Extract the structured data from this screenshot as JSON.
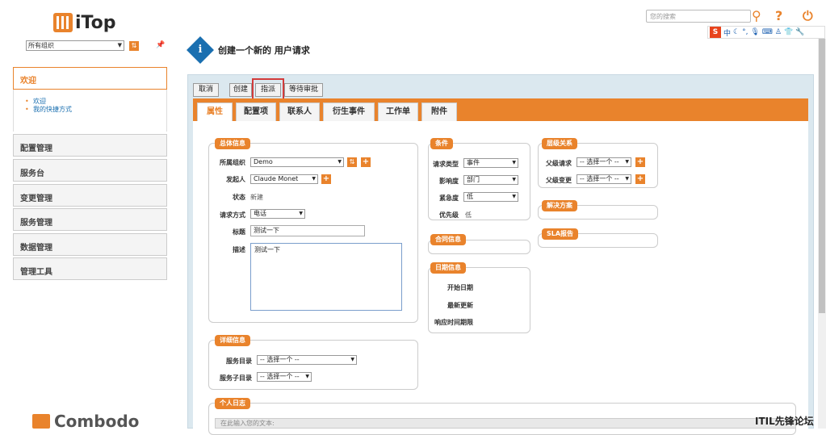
{
  "app": {
    "logo_text": "iTop",
    "footer_logo": "Combodo",
    "watermark": "ITIL先锋论坛"
  },
  "sidebar": {
    "org_select": "所有组织",
    "welcome": "欢迎",
    "sub": [
      "欢迎",
      "我的快捷方式"
    ],
    "items": [
      "配置管理",
      "服务台",
      "变更管理",
      "服务管理",
      "数据管理",
      "管理工具"
    ]
  },
  "topbar": {
    "search_placeholder": "您的搜索",
    "ime_mode": "中"
  },
  "page": {
    "title": "创建一个新的 用户请求",
    "actions": [
      "取消",
      "创建",
      "指派",
      "等待审批"
    ],
    "tabs": [
      "属性",
      "配置项",
      "联系人",
      "衍生事件",
      "工作单",
      "附件"
    ]
  },
  "general": {
    "legend": "总体信息",
    "org_label": "所属组织",
    "org_value": "Demo",
    "caller_label": "发起人",
    "caller_value": "Claude Monet",
    "status_label": "状态",
    "status_value": "新建",
    "origin_label": "请求方式",
    "origin_value": "电话",
    "title_label": "标题",
    "title_value": "测试一下",
    "desc_label": "描述",
    "desc_value": "测试一下"
  },
  "conditions": {
    "legend": "条件",
    "type_label": "请求类型",
    "type_value": "事件",
    "impact_label": "影响度",
    "impact_value": "部门",
    "urgency_label": "紧急度",
    "urgency_value": "低",
    "priority_label": "优先级",
    "priority_value": "低"
  },
  "contract": {
    "legend": "合同信息"
  },
  "dates": {
    "legend": "日期信息",
    "labels": [
      "开始日期",
      "最新更新",
      "响应时间期限"
    ]
  },
  "relations": {
    "legend": "层级关系",
    "parent_request_label": "父级请求",
    "parent_request_value": "-- 选择一个 --",
    "parent_change_label": "父级变更",
    "parent_change_value": "-- 选择一个 --"
  },
  "resolution": {
    "legend": "解决方案"
  },
  "sla": {
    "legend": "SLA报告"
  },
  "details": {
    "legend": "详细信息",
    "service_label": "服务目录",
    "service_value": "-- 选择一个 --",
    "subservice_label": "服务子目录",
    "subservice_value": "-- 选择一个 --"
  },
  "journal": {
    "legend": "个人日志",
    "placeholder": "在此输入您的文本:"
  }
}
